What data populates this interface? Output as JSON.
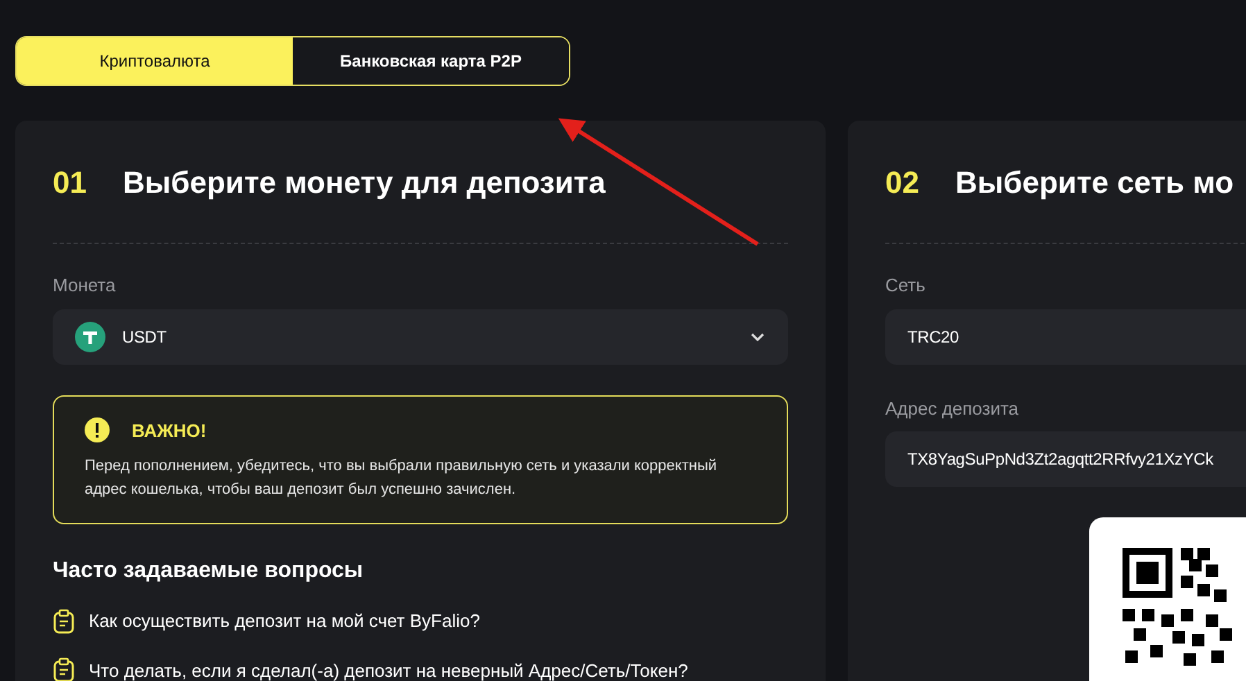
{
  "tabs": [
    {
      "label": "Криптовалюта",
      "selected": true
    },
    {
      "label": "Банковская карта P2P",
      "selected": false
    }
  ],
  "steps": [
    {
      "number": "01",
      "title": "Выберите монету для депозита",
      "fields": [
        {
          "label": "Монета",
          "value": "USDT",
          "kind": "coin-select"
        }
      ],
      "notice": {
        "title": "ВАЖНО!",
        "text": "Перед пополнением, убедитесь, что вы выбрали правильную сеть и указали корректный адрес кошелька, чтобы ваш депозит был успешно зачислен."
      },
      "faq": {
        "title": "Часто задаваемые вопросы",
        "items": [
          "Как осуществить депозит на мой счет ByFalio?",
          "Что делать, если я сделал(-а) депозит на неверный Адрес/Сеть/Токен?"
        ]
      }
    },
    {
      "number": "02",
      "title": "Выберите сеть мо",
      "fields": [
        {
          "label": "Сеть",
          "value": "TRC20",
          "kind": "plain"
        },
        {
          "label": "Адрес депозита",
          "value": "TX8YagSuPpNd3Zt2agqtt2RRfvy21XzYCk",
          "kind": "plain"
        }
      ]
    }
  ]
}
